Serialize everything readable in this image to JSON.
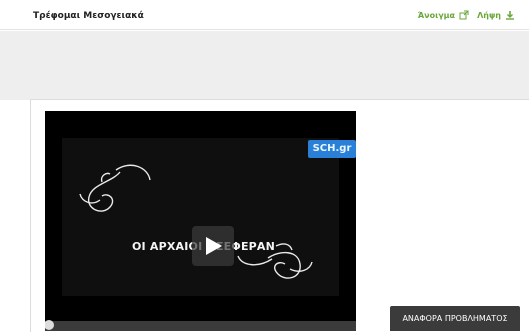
{
  "header": {
    "title": "Τρέφομαι Μεσογειακά",
    "open_label": "Άνοιγμα",
    "download_label": "Λήψη"
  },
  "video": {
    "logo": "SCH.gr",
    "title_overlay": "ΟΙ ΑΡΧΑΙΟΙ ΟΣΕΦΕΡΑΝ"
  },
  "report_button": "ΑΝΑΦΟΡΑ ΠΡΟΒΛΗΜΑΤΟΣ",
  "colors": {
    "accent": "#6aa53a",
    "logo_bg": "#2a7fd6"
  }
}
